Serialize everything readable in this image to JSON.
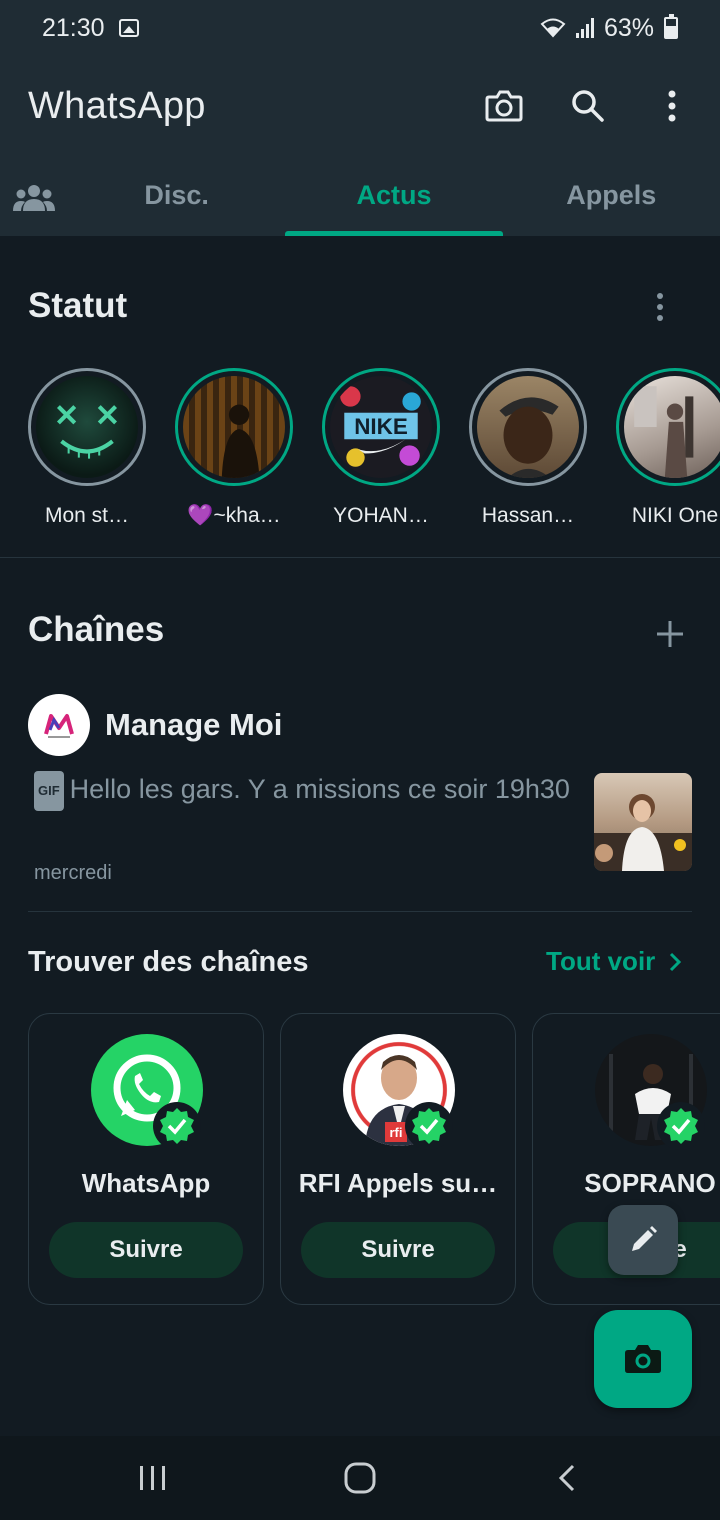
{
  "status_bar": {
    "time": "21:30",
    "battery": "63%"
  },
  "app": {
    "title": "WhatsApp"
  },
  "toolbar": {
    "camera_icon": "camera-icon",
    "search_icon": "search-icon",
    "more_icon": "more-vertical-icon"
  },
  "tabs": [
    {
      "label": "Disc.",
      "active": false
    },
    {
      "label": "Actus",
      "active": true
    },
    {
      "label": "Appels",
      "active": false
    }
  ],
  "statut": {
    "title": "Statut",
    "items": [
      {
        "label": "Mon st…",
        "seen": true
      },
      {
        "label": "💜~kha…",
        "seen": false
      },
      {
        "label": "YOHAN…",
        "seen": false
      },
      {
        "label": "Hassan…",
        "seen": true
      },
      {
        "label": "NIKI One",
        "seen": false
      }
    ]
  },
  "chaines": {
    "title": "Chaînes",
    "channel": {
      "name": "Manage Moi",
      "badge": "GIF",
      "message": "Hello les gars. Y a missions ce soir 19h30",
      "date": "mercredi"
    }
  },
  "find": {
    "title": "Trouver des chaînes",
    "see_all": "Tout voir",
    "cards": [
      {
        "name": "WhatsApp",
        "follow": "Suivre"
      },
      {
        "name": "RFI Appels su…",
        "follow": "Suivre"
      },
      {
        "name": "SOPRANO",
        "follow": "Suivre"
      }
    ]
  },
  "colors": {
    "accent": "#00a884",
    "background": "#121b22",
    "header": "#1f2c34"
  }
}
